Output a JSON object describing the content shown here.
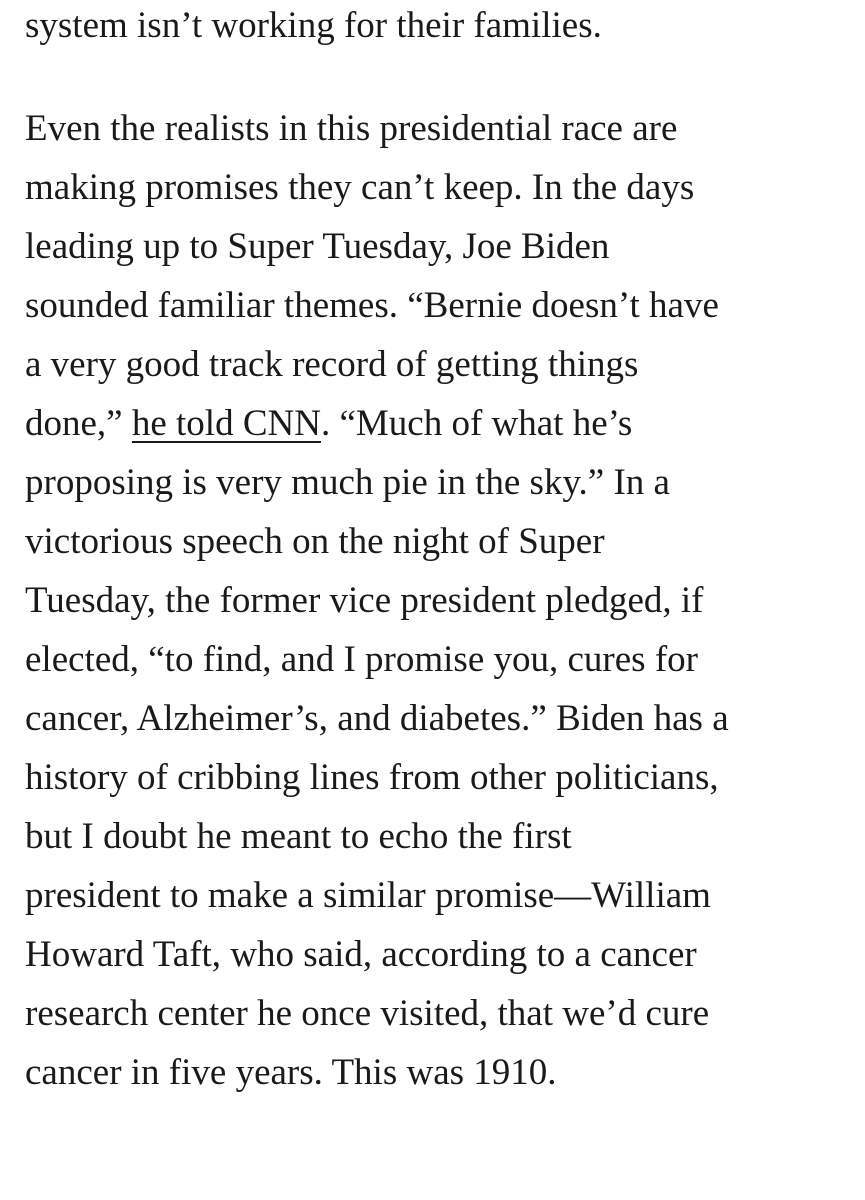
{
  "paragraph1": {
    "last_line": "system isn’t working for their families."
  },
  "paragraph2": {
    "lines": [
      "Even the realists in this presidential race are",
      "making promises they can’t keep. In the days",
      "leading up to Super Tuesday, Joe Biden",
      "sounded familiar themes. “Bernie doesn’t have",
      "a very good track record of getting things"
    ],
    "link_line": {
      "before": "done,” ",
      "link_text": "he told CNN",
      "after": ". “Much of what he’s"
    },
    "lines_after": [
      "proposing is very much pie in the sky.” In a",
      "victorious speech on the night of Super",
      "Tuesday, the former vice president pledged, if",
      "elected, “to find, and I promise you, cures for",
      "cancer, Alzheimer’s, and diabetes.” Biden has a",
      "history of cribbing lines from other politicians,",
      "but I doubt he meant to echo the first",
      "president to make a similar promise—William",
      "Howard Taft, who said, according to a cancer",
      "research center he once visited, that we’d cure",
      "cancer in five years. This was 1910."
    ]
  }
}
